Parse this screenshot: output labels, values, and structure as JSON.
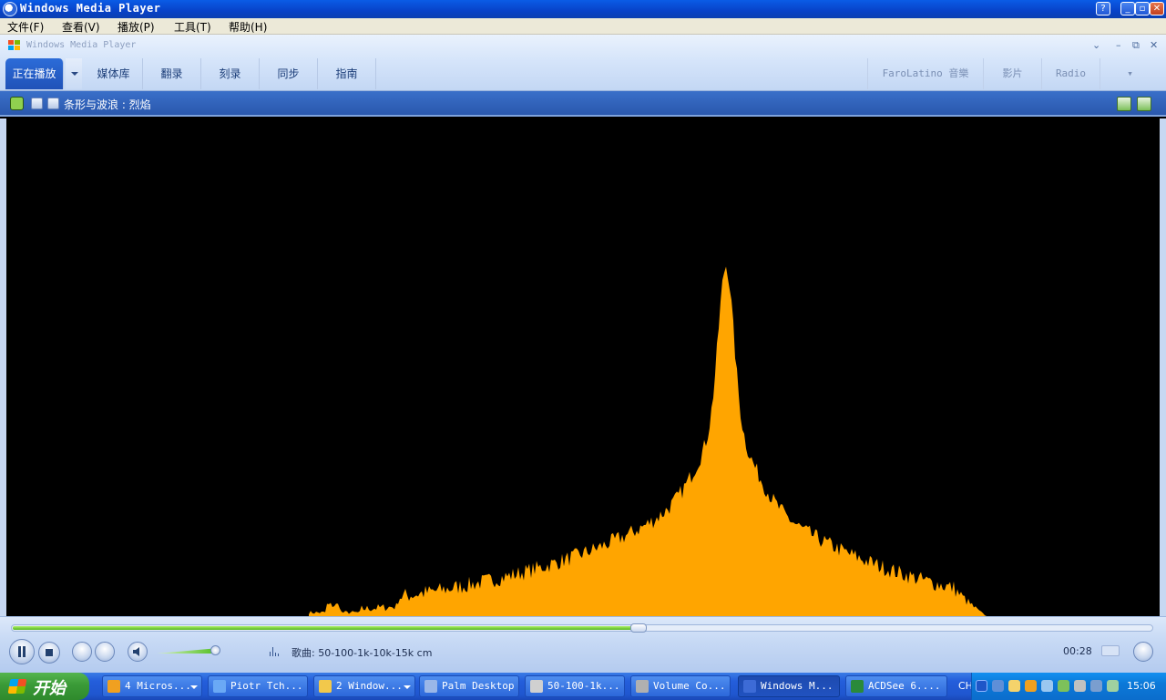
{
  "window": {
    "title": "Windows Media Player"
  },
  "menubar": {
    "items": [
      "文件(F)",
      "查看(V)",
      "播放(P)",
      "工具(T)",
      "帮助(H)"
    ]
  },
  "wmp": {
    "title": "Windows Media Player",
    "tabs": [
      "正在播放",
      "媒体库",
      "翻录",
      "刻录",
      "同步",
      "指南"
    ],
    "right_tabs": [
      "FaroLatino 音樂",
      "影片",
      "Radio"
    ]
  },
  "infobar": {
    "visualization": "条形与波浪 : 烈焰"
  },
  "player": {
    "status": "歌曲: 50-100-1k-10k-15k cm",
    "time": "00:28",
    "seek_progress": 0.55,
    "volume": 0.9
  },
  "visualizer": {
    "fill_color": "#ffa500",
    "background": "#000000"
  },
  "taskbar": {
    "start_label": "开始",
    "items": [
      {
        "label": "4 Micros...",
        "active": false,
        "color": "#f0a020",
        "dropdown": true
      },
      {
        "label": "Piotr Tch...",
        "active": false,
        "color": "#6aa9f5",
        "dropdown": false
      },
      {
        "label": "2 Window...",
        "active": false,
        "color": "#f2c84b",
        "dropdown": true
      },
      {
        "label": "Palm Desktop",
        "active": false,
        "color": "#9ab7e8",
        "dropdown": false
      },
      {
        "label": "50-100-1k...",
        "active": false,
        "color": "#d0d0d0",
        "dropdown": false
      },
      {
        "label": "Volume Co...",
        "active": false,
        "color": "#b0b0b0",
        "dropdown": false
      },
      {
        "label": "Windows M...",
        "active": true,
        "color": "#3d6bd6",
        "dropdown": false
      },
      {
        "label": "ACDSee 6....",
        "active": false,
        "color": "#2a8a3a",
        "dropdown": false
      }
    ],
    "lang": "CH",
    "clock": "15:06"
  }
}
